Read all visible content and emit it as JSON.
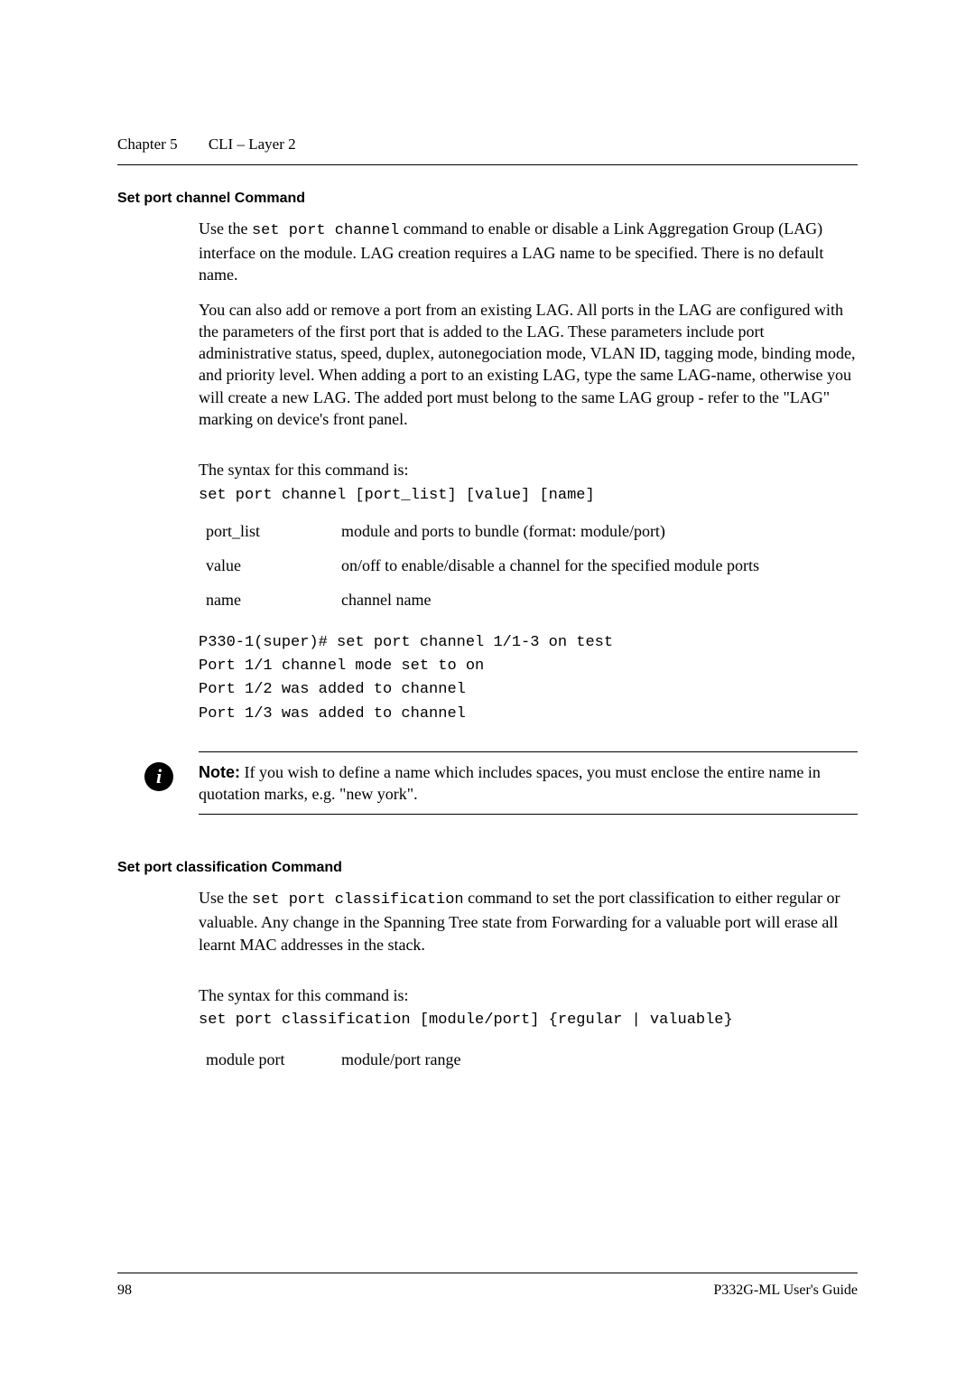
{
  "header": {
    "chapter": "Chapter 5",
    "title": "CLI – Layer 2"
  },
  "section1": {
    "heading": "Set port channel Command",
    "intro_prefix": "Use the ",
    "intro_code": "set port channel",
    "intro_suffix": " command to enable or disable a Link Aggregation Group (LAG) interface on the module. LAG creation requires a LAG name to be specified. There is no default name.",
    "paragraph2": "You can also add or remove a port from an existing LAG. All ports in the LAG are configured with the parameters of the first port that is added to the LAG. These parameters include port administrative status, speed, duplex, autonegociation mode, VLAN ID, tagging mode, binding mode, and priority level. When adding a port to an existing LAG, type the same LAG-name, otherwise you will create a new LAG. The added port must belong to the same LAG group - refer to the \"LAG\" marking on device's front panel.",
    "syntax_label": "The syntax for this command is:",
    "syntax_code": "set port channel [port_list] [value] [name]",
    "params": [
      {
        "name": "port_list",
        "desc": "module and ports to bundle (format: module/port)"
      },
      {
        "name": "value",
        "desc": "on/off to enable/disable a channel for the specified module ports"
      },
      {
        "name": "name",
        "desc": "channel name"
      }
    ],
    "example": [
      "P330-1(super)# set port channel 1/1-3 on test",
      "Port 1/1 channel mode set to on",
      "Port 1/2 was added to channel",
      "Port 1/3 was added to channel"
    ],
    "note_label": "Note:",
    "note_text": "  If you wish to define a name which includes spaces, you must enclose the entire name in quotation marks, e.g. \"new york\"."
  },
  "section2": {
    "heading": "Set port classification Command",
    "intro_prefix": "Use the ",
    "intro_code": "set port classification",
    "intro_suffix": " command to set the port classification to either regular or valuable. Any change in the Spanning Tree state from Forwarding for a valuable port will erase all learnt MAC addresses in the stack.",
    "syntax_label": "The syntax for this command is:",
    "syntax_code": "set port classification [module/port]  {regular | valuable}",
    "params": [
      {
        "name": "module port",
        "desc": "module/port range"
      }
    ]
  },
  "footer": {
    "page": "98",
    "guide": "P332G-ML User's Guide"
  }
}
